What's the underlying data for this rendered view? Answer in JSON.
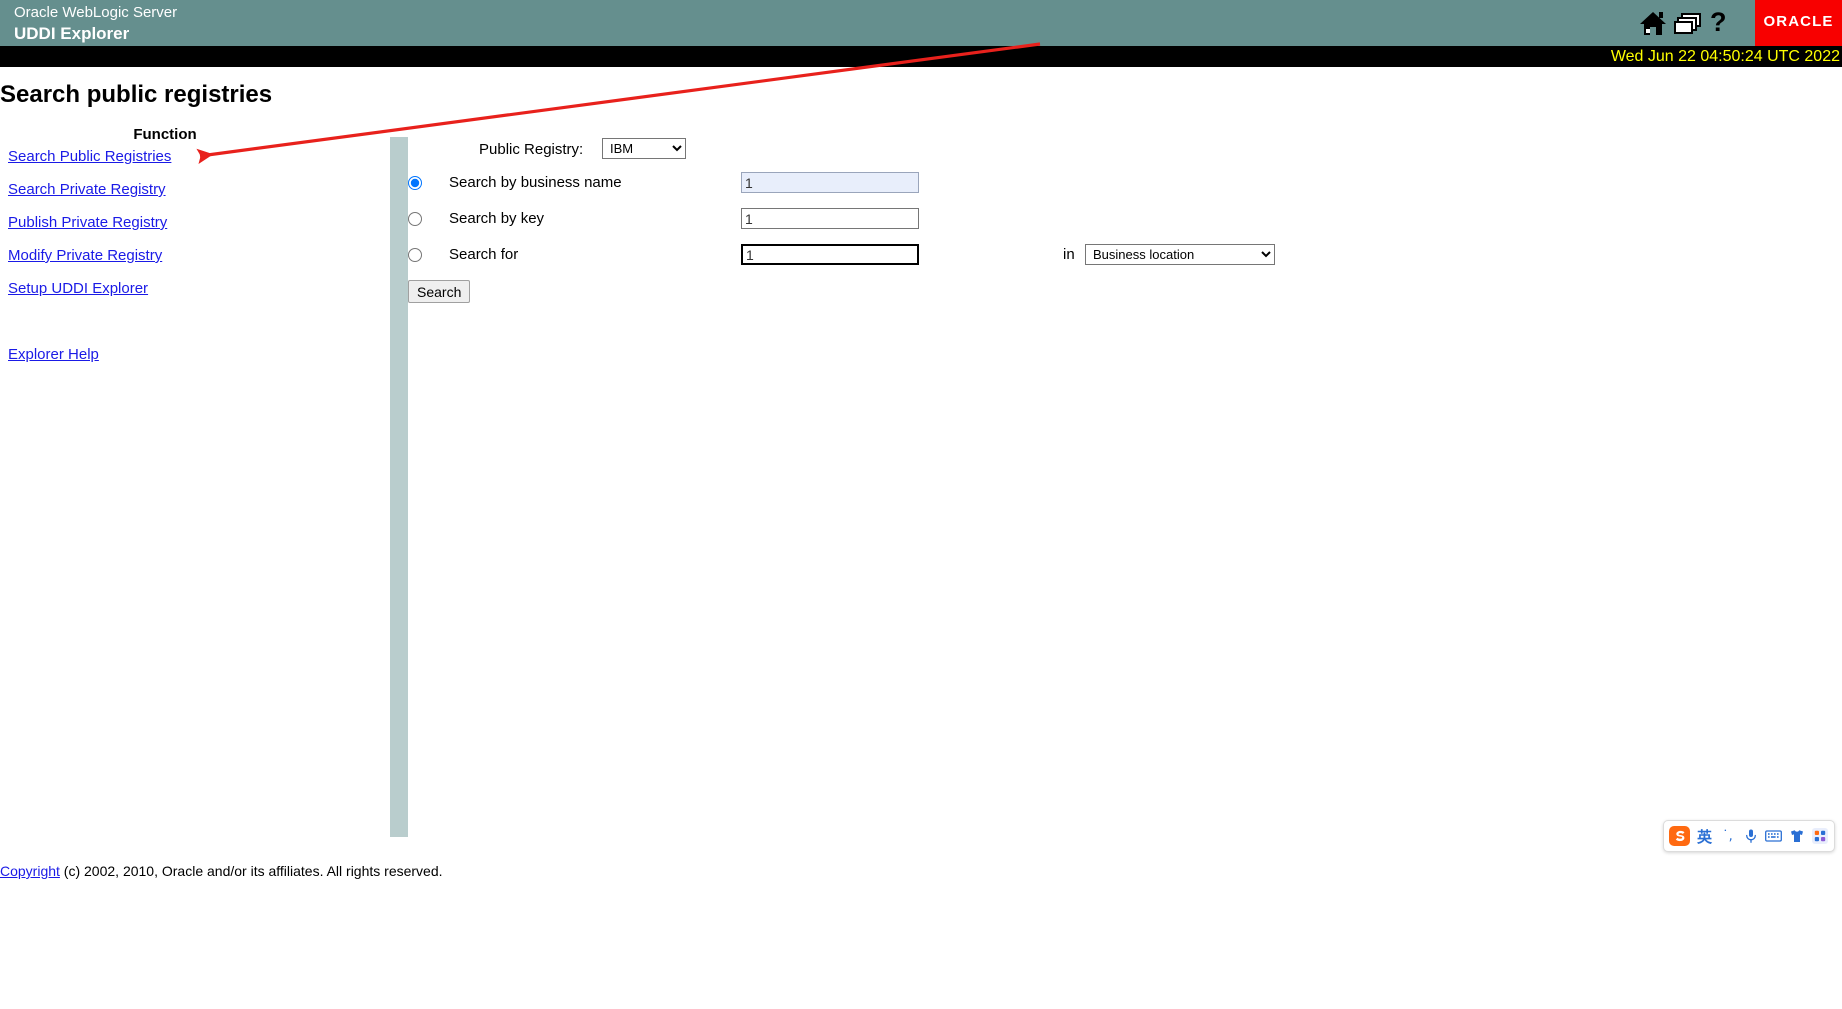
{
  "banner": {
    "product": "Oracle WebLogic Server",
    "app_title": "UDDI Explorer",
    "icons": [
      {
        "name": "home-icon",
        "label": "Home"
      },
      {
        "name": "windows-icon",
        "label": "Windows"
      },
      {
        "name": "help-icon",
        "label": "?"
      }
    ],
    "logo_text": "ORACLE",
    "logo_color": "#f80000",
    "background_color": "#658f8e"
  },
  "timestamp": {
    "text": "Wed Jun 22 04:50:24 UTC 2022",
    "color": "#ffff00",
    "background_color": "#000000"
  },
  "page": {
    "title": "Search public registries"
  },
  "sidebar": {
    "heading": "Function",
    "items": [
      {
        "label": "Search Public Registries"
      },
      {
        "label": "Search Private Registry"
      },
      {
        "label": "Publish Private Registry"
      },
      {
        "label": "Modify Private Registry"
      },
      {
        "label": "Setup UDDI Explorer"
      }
    ],
    "help_label": "Explorer Help",
    "link_color": "#1a1ae6"
  },
  "form": {
    "registry_label": "Public Registry:",
    "registry_selected": "IBM",
    "registry_options": [
      "IBM"
    ],
    "rows": [
      {
        "radio_label": "Search by business name",
        "selected": true,
        "input_value": "1"
      },
      {
        "radio_label": "Search by key",
        "selected": false,
        "input_value": "1"
      },
      {
        "radio_label": "Search for",
        "selected": false,
        "input_value": "1"
      }
    ],
    "in_label": "in",
    "in_selected": "Business location",
    "in_options": [
      "Business location"
    ],
    "search_button_label": "Search"
  },
  "footer": {
    "copyright_link": "Copyright",
    "copyright_text": " (c) 2002, 2010, Oracle and/or its affiliates. All rights reserved."
  },
  "annotation": {
    "arrow_color": "#e8211c"
  },
  "ime": {
    "logo_label": "S",
    "language_mode": "英",
    "punctuation": "˙,",
    "items": [
      {
        "name": "sogou-logo-icon"
      },
      {
        "name": "language-mode-icon"
      },
      {
        "name": "punctuation-icon"
      },
      {
        "name": "microphone-icon"
      },
      {
        "name": "keyboard-icon"
      },
      {
        "name": "skin-icon"
      },
      {
        "name": "app-grid-icon"
      }
    ]
  }
}
